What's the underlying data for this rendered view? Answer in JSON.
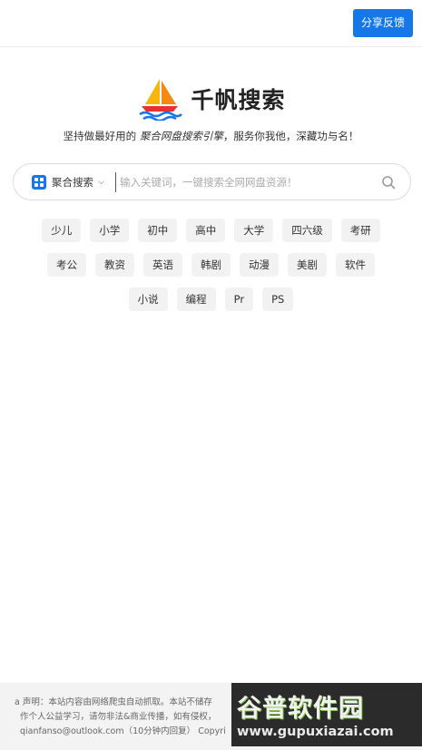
{
  "header": {
    "feedback_label": "分享反馈"
  },
  "brand": {
    "name": "千帆搜索"
  },
  "slogan": {
    "before": "坚持做最好用的 ",
    "emphasis": "聚合网盘搜索引擎",
    "after": "，服务你我他，深藏功与名！"
  },
  "search": {
    "mode_label": "聚合搜索",
    "placeholder": "输入关键词，一键搜索全网网盘资源！",
    "value": ""
  },
  "tags": {
    "row1": [
      "少儿",
      "小学",
      "初中",
      "高中",
      "大学",
      "四六级",
      "考研"
    ],
    "row2": [
      "考公",
      "教资",
      "英语",
      "韩剧",
      "动漫",
      "美剧",
      "软件"
    ],
    "row3": [
      "小说",
      "编程",
      "Pr",
      "PS"
    ]
  },
  "footer": {
    "line1": "a 声明：本站内容由网络爬虫自动抓取。本站不储存",
    "line2": "作个人公益学习，请勿非法&商业传播，如有侵权，",
    "line3": "qianfanso@outlook.com（10分钟内回复） Copyri"
  },
  "watermark": {
    "title": "谷普软件园",
    "url": "www.gupuxiazai.com"
  },
  "colors": {
    "accent": "#1677e8",
    "tag_bg": "#f2f2f2",
    "footer_bg": "#f3f3f3"
  }
}
